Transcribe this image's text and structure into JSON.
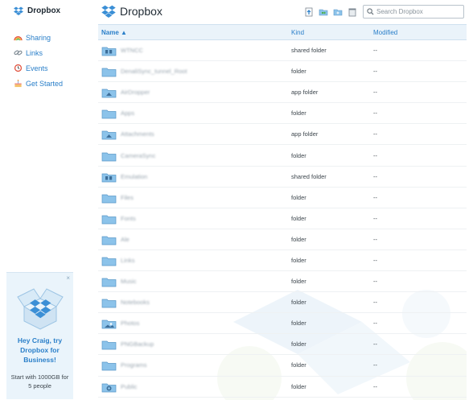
{
  "app": {
    "brand": "Dropbox",
    "title": "Dropbox"
  },
  "sidebar": {
    "items": [
      {
        "label": "Sharing",
        "icon": "rainbow-icon"
      },
      {
        "label": "Links",
        "icon": "chain-link-icon"
      },
      {
        "label": "Events",
        "icon": "clock-icon"
      },
      {
        "label": "Get Started",
        "icon": "cake-icon"
      }
    ]
  },
  "promo": {
    "close": "×",
    "title": "Hey Craig, try Dropbox for Business!",
    "subtitle": "Start with 1000GB for 5 people"
  },
  "toolbar": {
    "icons": [
      "upload-icon",
      "new-shared-folder-icon",
      "new-folder-icon",
      "show-deleted-icon"
    ]
  },
  "search": {
    "placeholder": "Search Dropbox"
  },
  "table": {
    "headers": {
      "name": "Name ▲",
      "kind": "Kind",
      "modified": "Modified"
    },
    "rows": [
      {
        "name": "WTNCC",
        "kind": "shared folder",
        "modified": "--",
        "icon": "shared-folder-icon"
      },
      {
        "name": "DenaliSync_tunnel_Root",
        "kind": "folder",
        "modified": "--",
        "icon": "folder-icon"
      },
      {
        "name": "AirDropper",
        "kind": "app folder",
        "modified": "--",
        "icon": "app-folder-icon"
      },
      {
        "name": "Apps",
        "kind": "folder",
        "modified": "--",
        "icon": "folder-icon"
      },
      {
        "name": "Attachments",
        "kind": "app folder",
        "modified": "--",
        "icon": "app-folder-icon"
      },
      {
        "name": "CameraSync",
        "kind": "folder",
        "modified": "--",
        "icon": "folder-icon"
      },
      {
        "name": "Emulation",
        "kind": "shared folder",
        "modified": "--",
        "icon": "shared-folder-icon"
      },
      {
        "name": "Files",
        "kind": "folder",
        "modified": "--",
        "icon": "folder-icon"
      },
      {
        "name": "Fonts",
        "kind": "folder",
        "modified": "--",
        "icon": "folder-icon"
      },
      {
        "name": "Ale",
        "kind": "folder",
        "modified": "--",
        "icon": "folder-icon"
      },
      {
        "name": "Links",
        "kind": "folder",
        "modified": "--",
        "icon": "folder-icon"
      },
      {
        "name": "Music",
        "kind": "folder",
        "modified": "--",
        "icon": "folder-icon"
      },
      {
        "name": "Notebooks",
        "kind": "folder",
        "modified": "--",
        "icon": "folder-icon"
      },
      {
        "name": "Photos",
        "kind": "folder",
        "modified": "--",
        "icon": "photos-folder-icon"
      },
      {
        "name": "PNGBackup",
        "kind": "folder",
        "modified": "--",
        "icon": "folder-icon"
      },
      {
        "name": "Programs",
        "kind": "folder",
        "modified": "--",
        "icon": "folder-icon"
      },
      {
        "name": "Public",
        "kind": "folder",
        "modified": "--",
        "icon": "public-folder-icon"
      }
    ]
  },
  "colors": {
    "accent": "#2a7fc9",
    "header_bg": "#eaf3fa",
    "folder": "#8cc3ea"
  }
}
